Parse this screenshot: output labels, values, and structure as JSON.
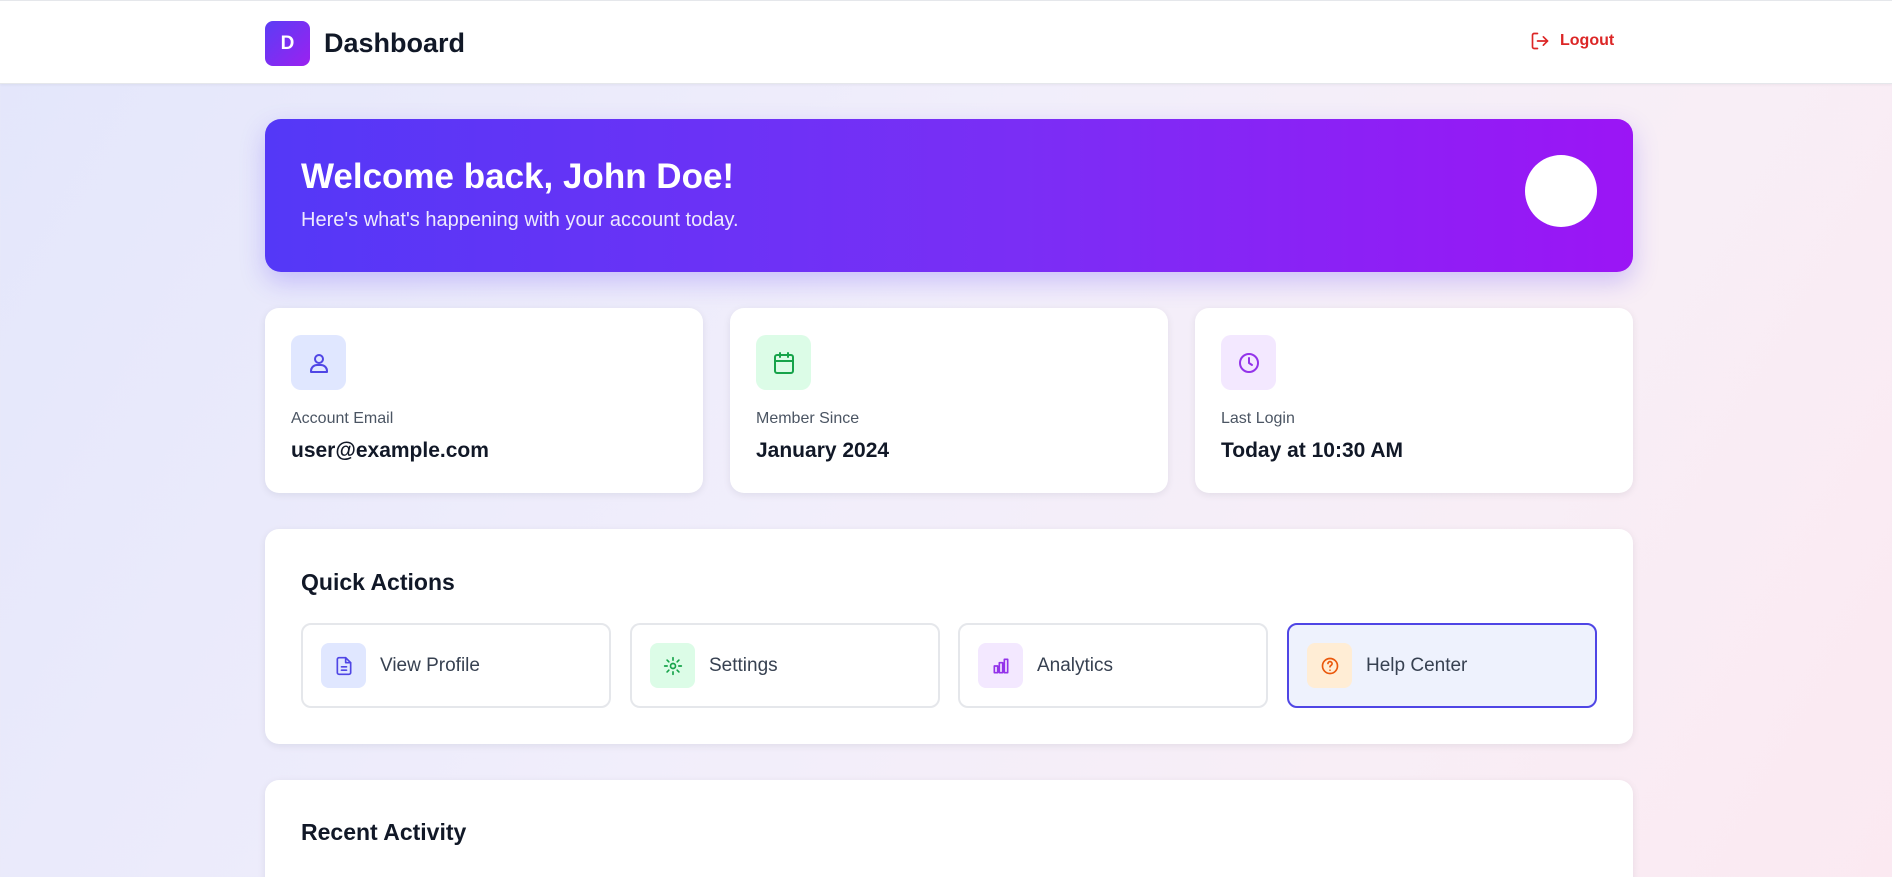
{
  "header": {
    "logo_letter": "D",
    "title": "Dashboard",
    "logout_label": "Logout"
  },
  "hero": {
    "title": "Welcome back, John Doe!",
    "subtitle": "Here's what's happening with your account today."
  },
  "stats": [
    {
      "label": "Account Email",
      "value": "user@example.com",
      "icon": "user-icon"
    },
    {
      "label": "Member Since",
      "value": "January 2024",
      "icon": "calendar-icon"
    },
    {
      "label": "Last Login",
      "value": "Today at 10:30 AM",
      "icon": "clock-icon"
    }
  ],
  "quick_actions": {
    "title": "Quick Actions",
    "items": [
      {
        "label": "View Profile",
        "icon": "document-icon"
      },
      {
        "label": "Settings",
        "icon": "gear-icon"
      },
      {
        "label": "Analytics",
        "icon": "bar-chart-icon"
      },
      {
        "label": "Help Center",
        "icon": "help-circle-icon"
      }
    ]
  },
  "recent_activity": {
    "title": "Recent Activity"
  },
  "colors": {
    "primary": "#5438f7",
    "accent_purple": "#9b15f5",
    "logout_red": "#dc2626",
    "green": "#16a34a",
    "orange": "#ea580c"
  }
}
